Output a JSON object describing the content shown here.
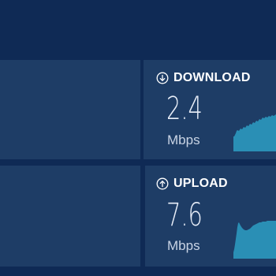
{
  "download": {
    "label": "DOWNLOAD",
    "value": "2.4",
    "unit": "Mbps",
    "icon": "arrow-down-circle-icon",
    "chart_color": "#2a8fb5"
  },
  "upload": {
    "label": "UPLOAD",
    "value": "7.6",
    "unit": "Mbps",
    "icon": "arrow-up-circle-icon",
    "chart_color": "#2a8fb5"
  },
  "colors": {
    "background": "#0f2a55",
    "panel": "#1e3d66",
    "text": "#ffffff"
  }
}
